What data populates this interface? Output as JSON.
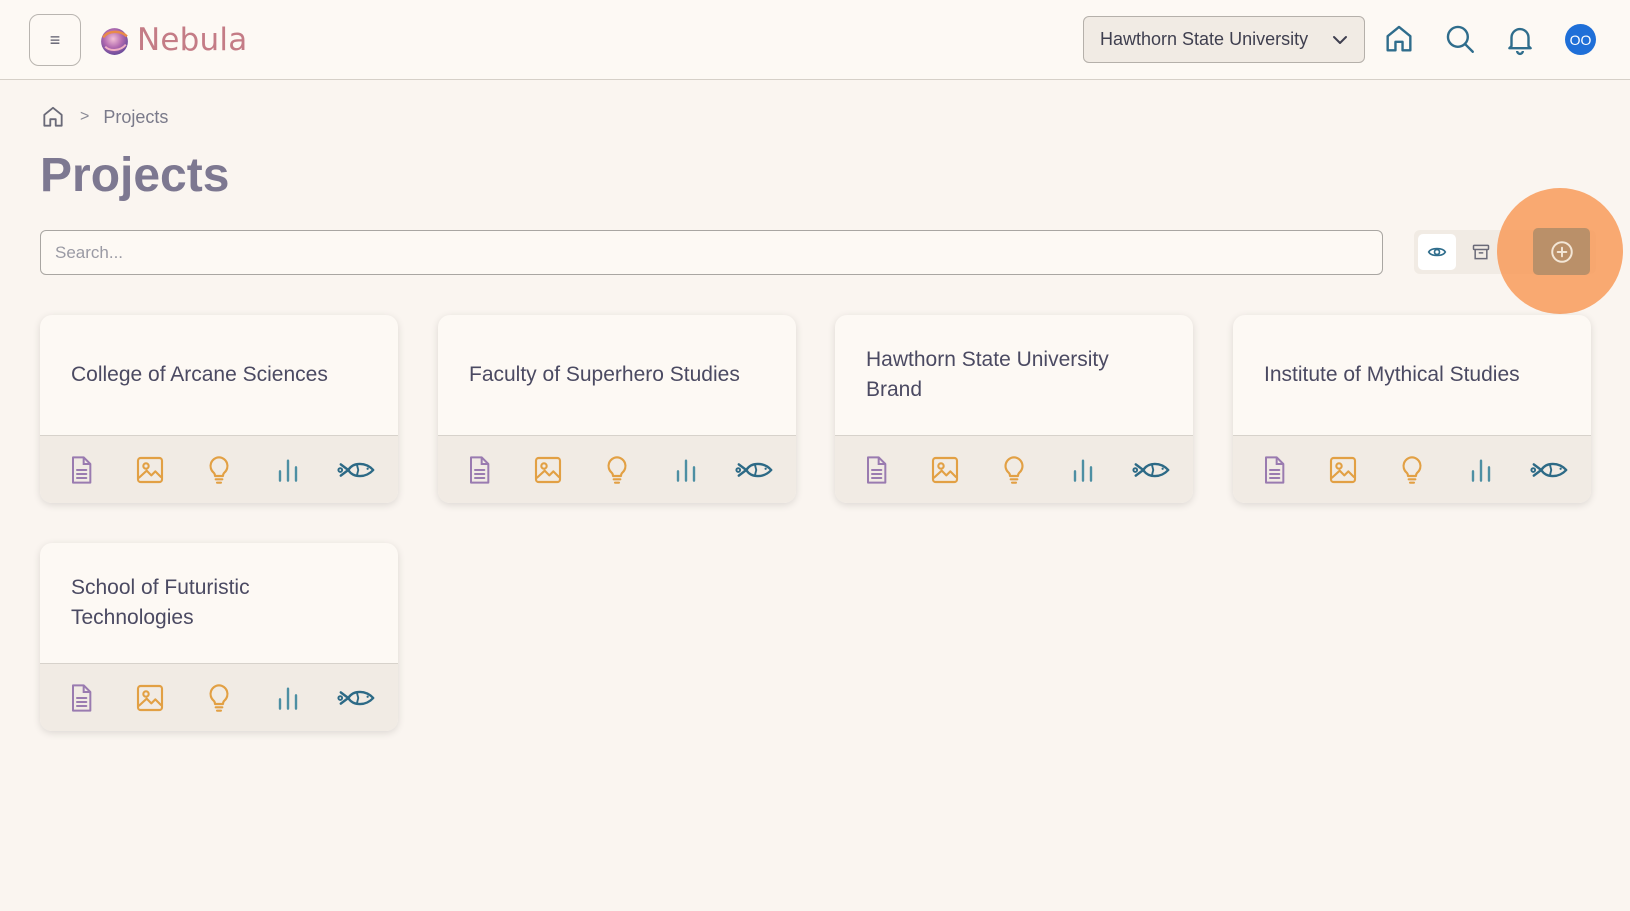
{
  "header": {
    "menu_icon": "hamburger-icon",
    "brand": "Nebula",
    "org_selector": "Hawthorn State University",
    "avatar_initials": "OO",
    "icons": [
      "home-icon",
      "search-icon",
      "bell-icon"
    ]
  },
  "breadcrumb": {
    "current": "Projects",
    "separator": ">"
  },
  "page": {
    "title": "Projects"
  },
  "search": {
    "placeholder": "Search..."
  },
  "colors": {
    "doc": "#9a7bb0",
    "image": "#e2a044",
    "bulb": "#e2a044",
    "chart": "#4d8fa3",
    "fish": "#2d6a86",
    "add_button": "#ba9069",
    "highlight": "#f89b5a"
  },
  "cards": [
    {
      "title": "College of Arcane Sciences"
    },
    {
      "title": "Faculty of Superhero Studies"
    },
    {
      "title": "Hawthorn State University Brand"
    },
    {
      "title": "Institute of Mythical Studies"
    },
    {
      "title": "School of Futuristic Technologies"
    }
  ],
  "card_action_icons": [
    "document-icon",
    "image-icon",
    "lightbulb-icon",
    "bar-chart-icon",
    "fish-icon"
  ]
}
